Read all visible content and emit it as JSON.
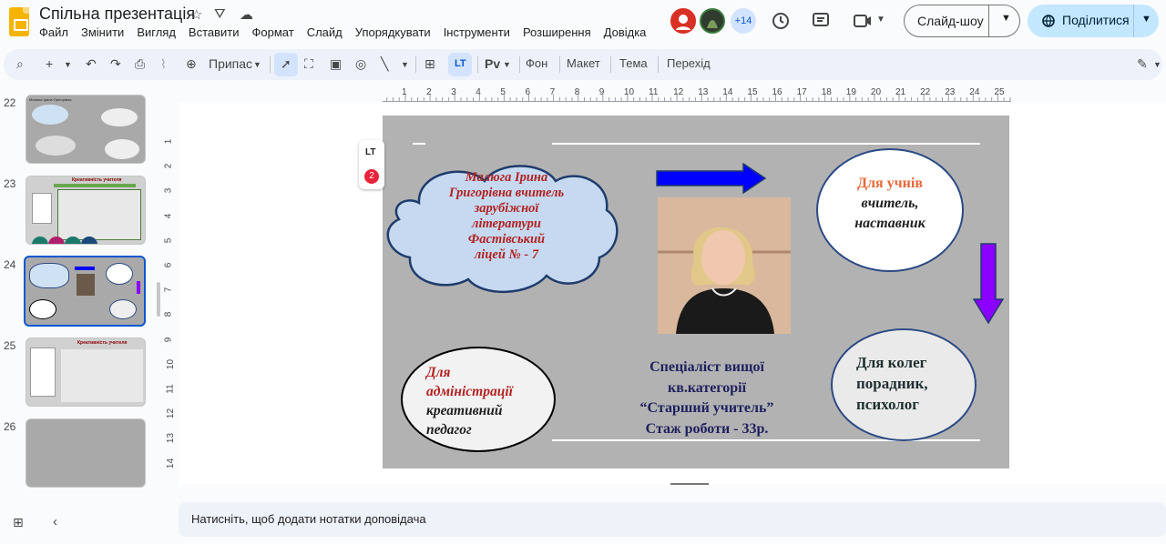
{
  "app": {
    "title": "Спільна презентація",
    "menu": [
      "Файл",
      "Змінити",
      "Вигляд",
      "Вставити",
      "Формат",
      "Слайд",
      "Упорядкувати",
      "Інструменти",
      "Розширення",
      "Довідка"
    ],
    "extra_users": "+14",
    "slideshow_label": "Слайд-шоу",
    "share_label": "Поділитися"
  },
  "toolbar": {
    "zoom_label": "Припас",
    "font_label": "Рv",
    "background_label": "Фон",
    "layout_label": "Макет",
    "theme_label": "Тема",
    "transition_label": "Перехід"
  },
  "ruler": {
    "h": [
      "1",
      "2",
      "3",
      "4",
      "5",
      "6",
      "7",
      "8",
      "9",
      "10",
      "11",
      "12",
      "13",
      "14",
      "15",
      "16",
      "17",
      "18",
      "19",
      "20",
      "21",
      "22",
      "23",
      "24",
      "25"
    ],
    "v": [
      "1",
      "2",
      "3",
      "4",
      "5",
      "6",
      "7",
      "8",
      "9",
      "10",
      "11",
      "12",
      "13",
      "14"
    ]
  },
  "filmstrip": [
    {
      "num": "22",
      "title": "Малюга Ірина Григорівна"
    },
    {
      "num": "23",
      "title": "Креативність учителя"
    },
    {
      "num": "24",
      "title": ""
    },
    {
      "num": "25",
      "title": "Креативність учителя"
    },
    {
      "num": "26",
      "title": ""
    }
  ],
  "slide": {
    "cloud_lines": [
      "Малюга Ірина",
      "Григорівна вчитель",
      "зарубіжної",
      "літератури",
      "Фастівський",
      "ліцей № - 7"
    ],
    "students_title": "Для учнів",
    "students_lines": [
      "вчитель,",
      "наставник"
    ],
    "admin_title_lines": [
      "Для",
      "адміністрації"
    ],
    "admin_lines": [
      "креативний",
      "педагог"
    ],
    "spec_lines": [
      "Спеціаліст вищої",
      "кв.категорії",
      "“Старший учитель”",
      "Стаж роботи - 33р."
    ],
    "colleagues_title": "Для колег",
    "colleagues_lines": [
      "порадник,",
      "психолог"
    ]
  },
  "comments_count": "2",
  "notes_placeholder": "Натисніть, щоб додати нотатки доповідача",
  "colors": {
    "accent": "#c2e7ff",
    "slide_bg": "#b2b2b2",
    "oval_border": "#2c4a84",
    "title_red": "#b22222",
    "students_orange": "#e8683a",
    "arrow_blue": "#0000ff",
    "arrow_purple": "#8b00ff"
  }
}
